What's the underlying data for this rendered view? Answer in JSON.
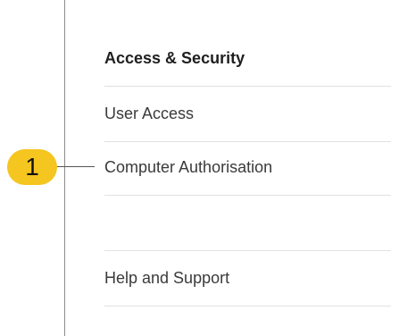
{
  "menu": {
    "header": "Access & Security",
    "items": [
      {
        "label": "User Access"
      },
      {
        "label": "Computer Authorisation"
      },
      {
        "label": ""
      },
      {
        "label": "Help and Support"
      }
    ]
  },
  "callout": {
    "number": "1",
    "color": "#f5c520"
  }
}
